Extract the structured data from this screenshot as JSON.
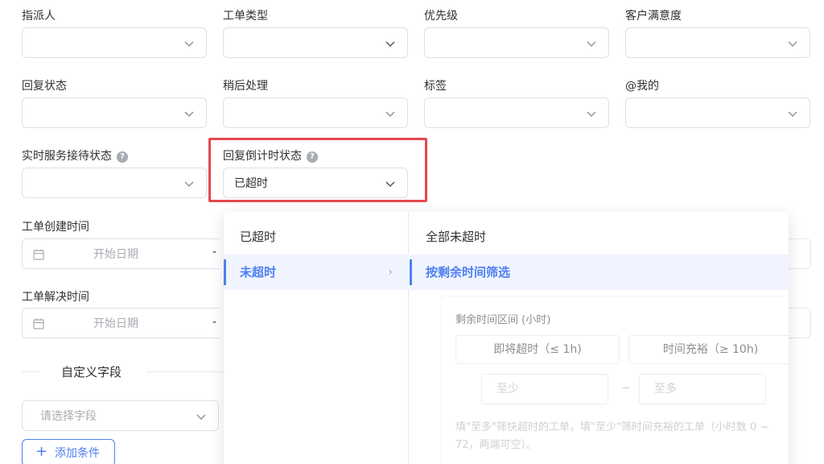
{
  "filters": {
    "row1": [
      {
        "label": "指派人",
        "value": ""
      },
      {
        "label": "工单类型",
        "value": ""
      },
      {
        "label": "优先级",
        "value": ""
      },
      {
        "label": "客户满意度",
        "value": ""
      }
    ],
    "row2": [
      {
        "label": "回复状态",
        "value": ""
      },
      {
        "label": "稍后处理",
        "value": ""
      },
      {
        "label": "标签",
        "value": ""
      },
      {
        "label": "@我的",
        "value": ""
      }
    ],
    "realtime_status": {
      "label": "实时服务接待状态",
      "value": ""
    },
    "countdown_status": {
      "label": "回复倒计时状态",
      "value": "已超时"
    },
    "help_glyph": "?"
  },
  "dates": {
    "created": {
      "label": "工单创建时间",
      "placeholder": "开始日期",
      "separator": "-"
    },
    "resolved": {
      "label": "工单解决时间",
      "placeholder": "开始日期",
      "separator": "-"
    }
  },
  "custom_fields": {
    "title": "自定义字段",
    "select_placeholder": "请选择字段",
    "add_label": "添加条件",
    "add_icon": "+"
  },
  "dropdown": {
    "level1": [
      {
        "label": "已超时",
        "active": false
      },
      {
        "label": "未超时",
        "active": true,
        "arrow": "›"
      }
    ],
    "level2": [
      {
        "label": "全部未超时",
        "active": false
      },
      {
        "label": "按剩余时间筛选",
        "active": true
      }
    ],
    "panel": {
      "title": "剩余时间区间 (小时)",
      "quick_buttons": [
        "即将超时（≤ 1h)",
        "时间充裕（≥ 10h)"
      ],
      "min_placeholder": "至少",
      "max_placeholder": "至多",
      "range_separator": "~",
      "hint": "填\"至多\"筛快超时的工单，填\"至少\"筛时间充裕的工单（小时数 0 ~ 72，两端可空）。"
    }
  },
  "colors": {
    "accent": "#4e7ff1",
    "highlight": "#e5484d",
    "border": "#dcdfe6"
  }
}
